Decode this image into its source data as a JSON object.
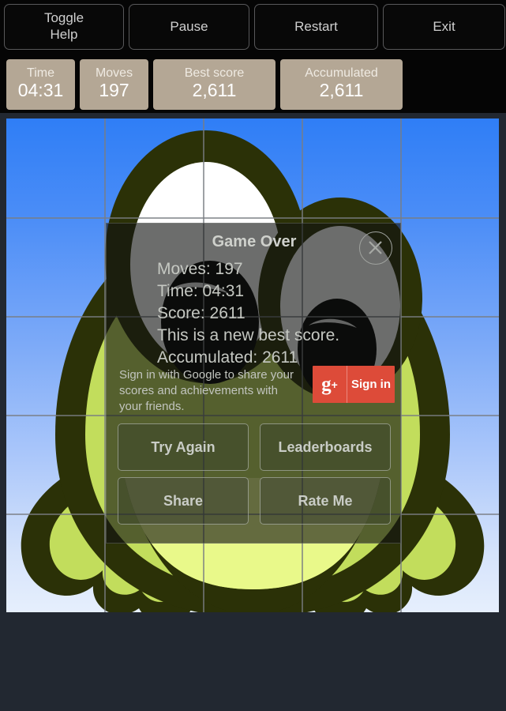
{
  "controls": [
    {
      "id": "toggle-help",
      "label": "Toggle\nHelp",
      "line1": "Toggle",
      "line2": "Help"
    },
    {
      "id": "pause",
      "label": "Pause"
    },
    {
      "id": "restart",
      "label": "Restart"
    },
    {
      "id": "exit",
      "label": "Exit"
    }
  ],
  "stats": [
    {
      "id": "time",
      "label": "Time",
      "value": "04:31"
    },
    {
      "id": "moves",
      "label": "Moves",
      "value": "197"
    },
    {
      "id": "best-score",
      "label": "Best score",
      "value": "2,611"
    },
    {
      "id": "accumulated",
      "label": "Accumulated",
      "value": "2,611"
    }
  ],
  "board": {
    "grid_cols": 5,
    "grid_rows": 5,
    "image_subject": "cartoon-frog",
    "colors": {
      "sky_top": "#2f7ef6",
      "sky_bottom": "#e3edfd",
      "frog_outline": "#2b3107",
      "frog_body": "#c2dd5c",
      "eye_white": "#ffffff",
      "pupil": "#000000",
      "grid_line": "#787d82"
    }
  },
  "dialog": {
    "title": "Game Over",
    "close_icon": "close-icon",
    "stats_lines": [
      "Moves: 197",
      "Time: 04:31",
      "Score: 2611",
      "This is a new best score.",
      "Accumulated: 2611"
    ],
    "signin_text": "Sign in with Google to share your scores and achievements with your friends.",
    "gplus": {
      "icon": "g+",
      "label": "Sign in",
      "color": "#dd4b39"
    },
    "actions": [
      {
        "id": "try-again",
        "label": "Try Again"
      },
      {
        "id": "leaderboards",
        "label": "Leaderboards"
      },
      {
        "id": "share",
        "label": "Share"
      },
      {
        "id": "rate-me",
        "label": "Rate Me"
      }
    ]
  },
  "theme": {
    "background": "#222831",
    "topbar": "#050505",
    "stat_chip": "#b4a795",
    "accent": "#dd4b39"
  }
}
